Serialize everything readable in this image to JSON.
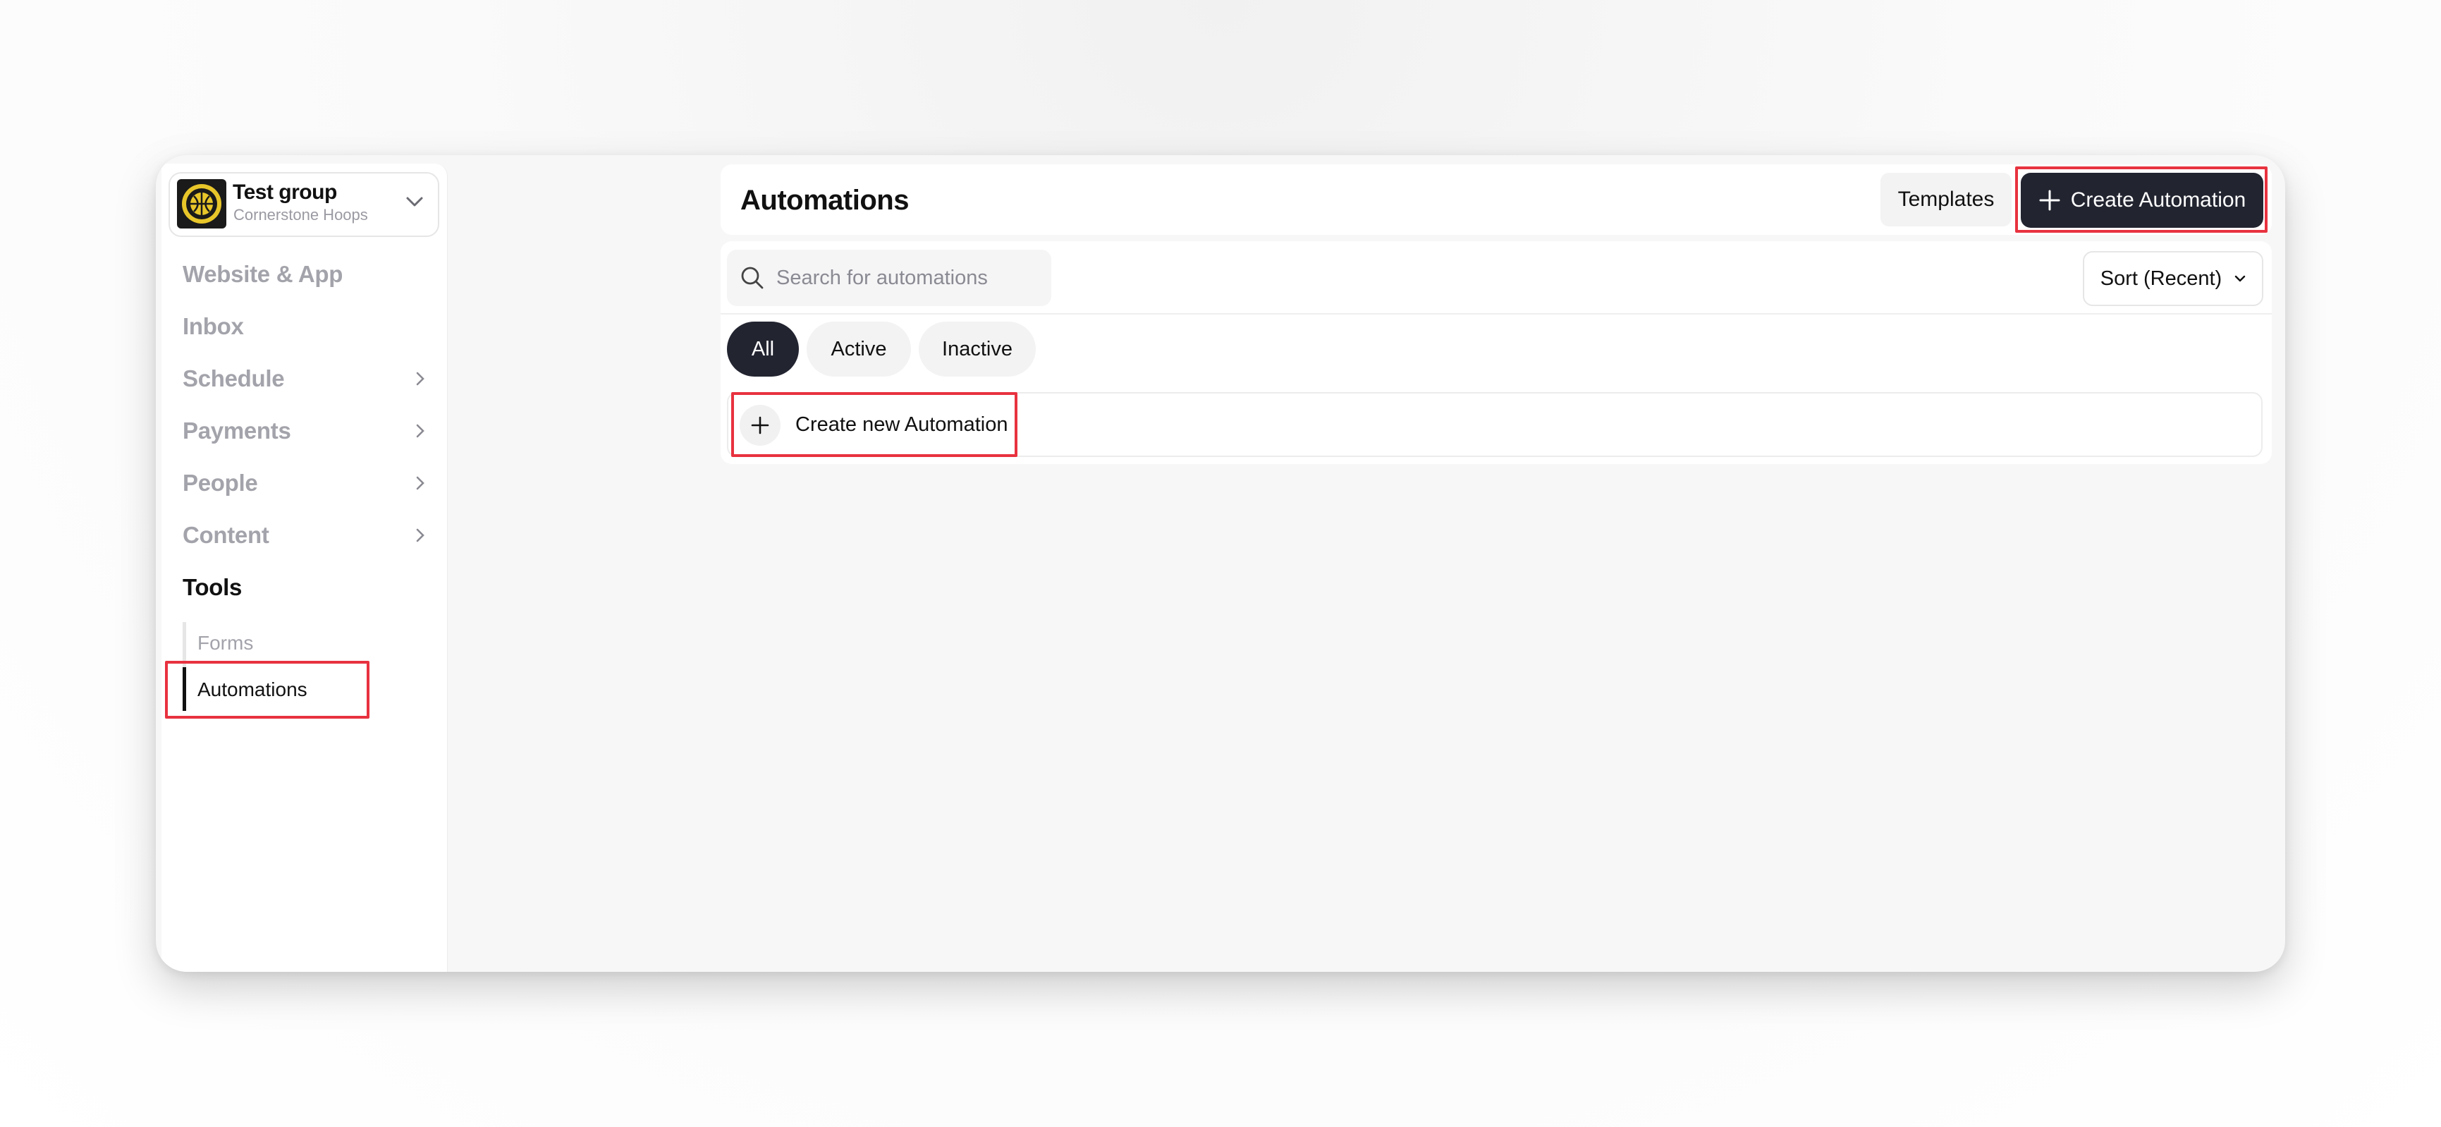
{
  "group": {
    "title": "Test group",
    "subtitle": "Cornerstone Hoops",
    "logo_icon": "basketball-crest-icon"
  },
  "sidebar": {
    "items": [
      {
        "label": "Website & App",
        "has_chevron": false
      },
      {
        "label": "Inbox",
        "has_chevron": false
      },
      {
        "label": "Schedule",
        "has_chevron": true
      },
      {
        "label": "Payments",
        "has_chevron": true
      },
      {
        "label": "People",
        "has_chevron": true
      },
      {
        "label": "Content",
        "has_chevron": true
      },
      {
        "label": "Tools",
        "has_chevron": false,
        "expanded": true
      }
    ],
    "tools_subitems": [
      {
        "label": "Forms",
        "selected": false
      },
      {
        "label": "Automations",
        "selected": true
      }
    ]
  },
  "header": {
    "title": "Automations",
    "templates_label": "Templates",
    "create_label": "Create Automation"
  },
  "toolbar": {
    "search_placeholder": "Search for automations",
    "search_value": "",
    "sort_label": "Sort (Recent)"
  },
  "filters": {
    "all": "All",
    "active": "Active",
    "inactive": "Inactive",
    "selected": "All"
  },
  "list": {
    "create_new_label": "Create new Automation"
  },
  "colors": {
    "accent_dark": "#222430",
    "highlight_red": "#e8323f",
    "nav_muted": "#a3a3ab"
  }
}
